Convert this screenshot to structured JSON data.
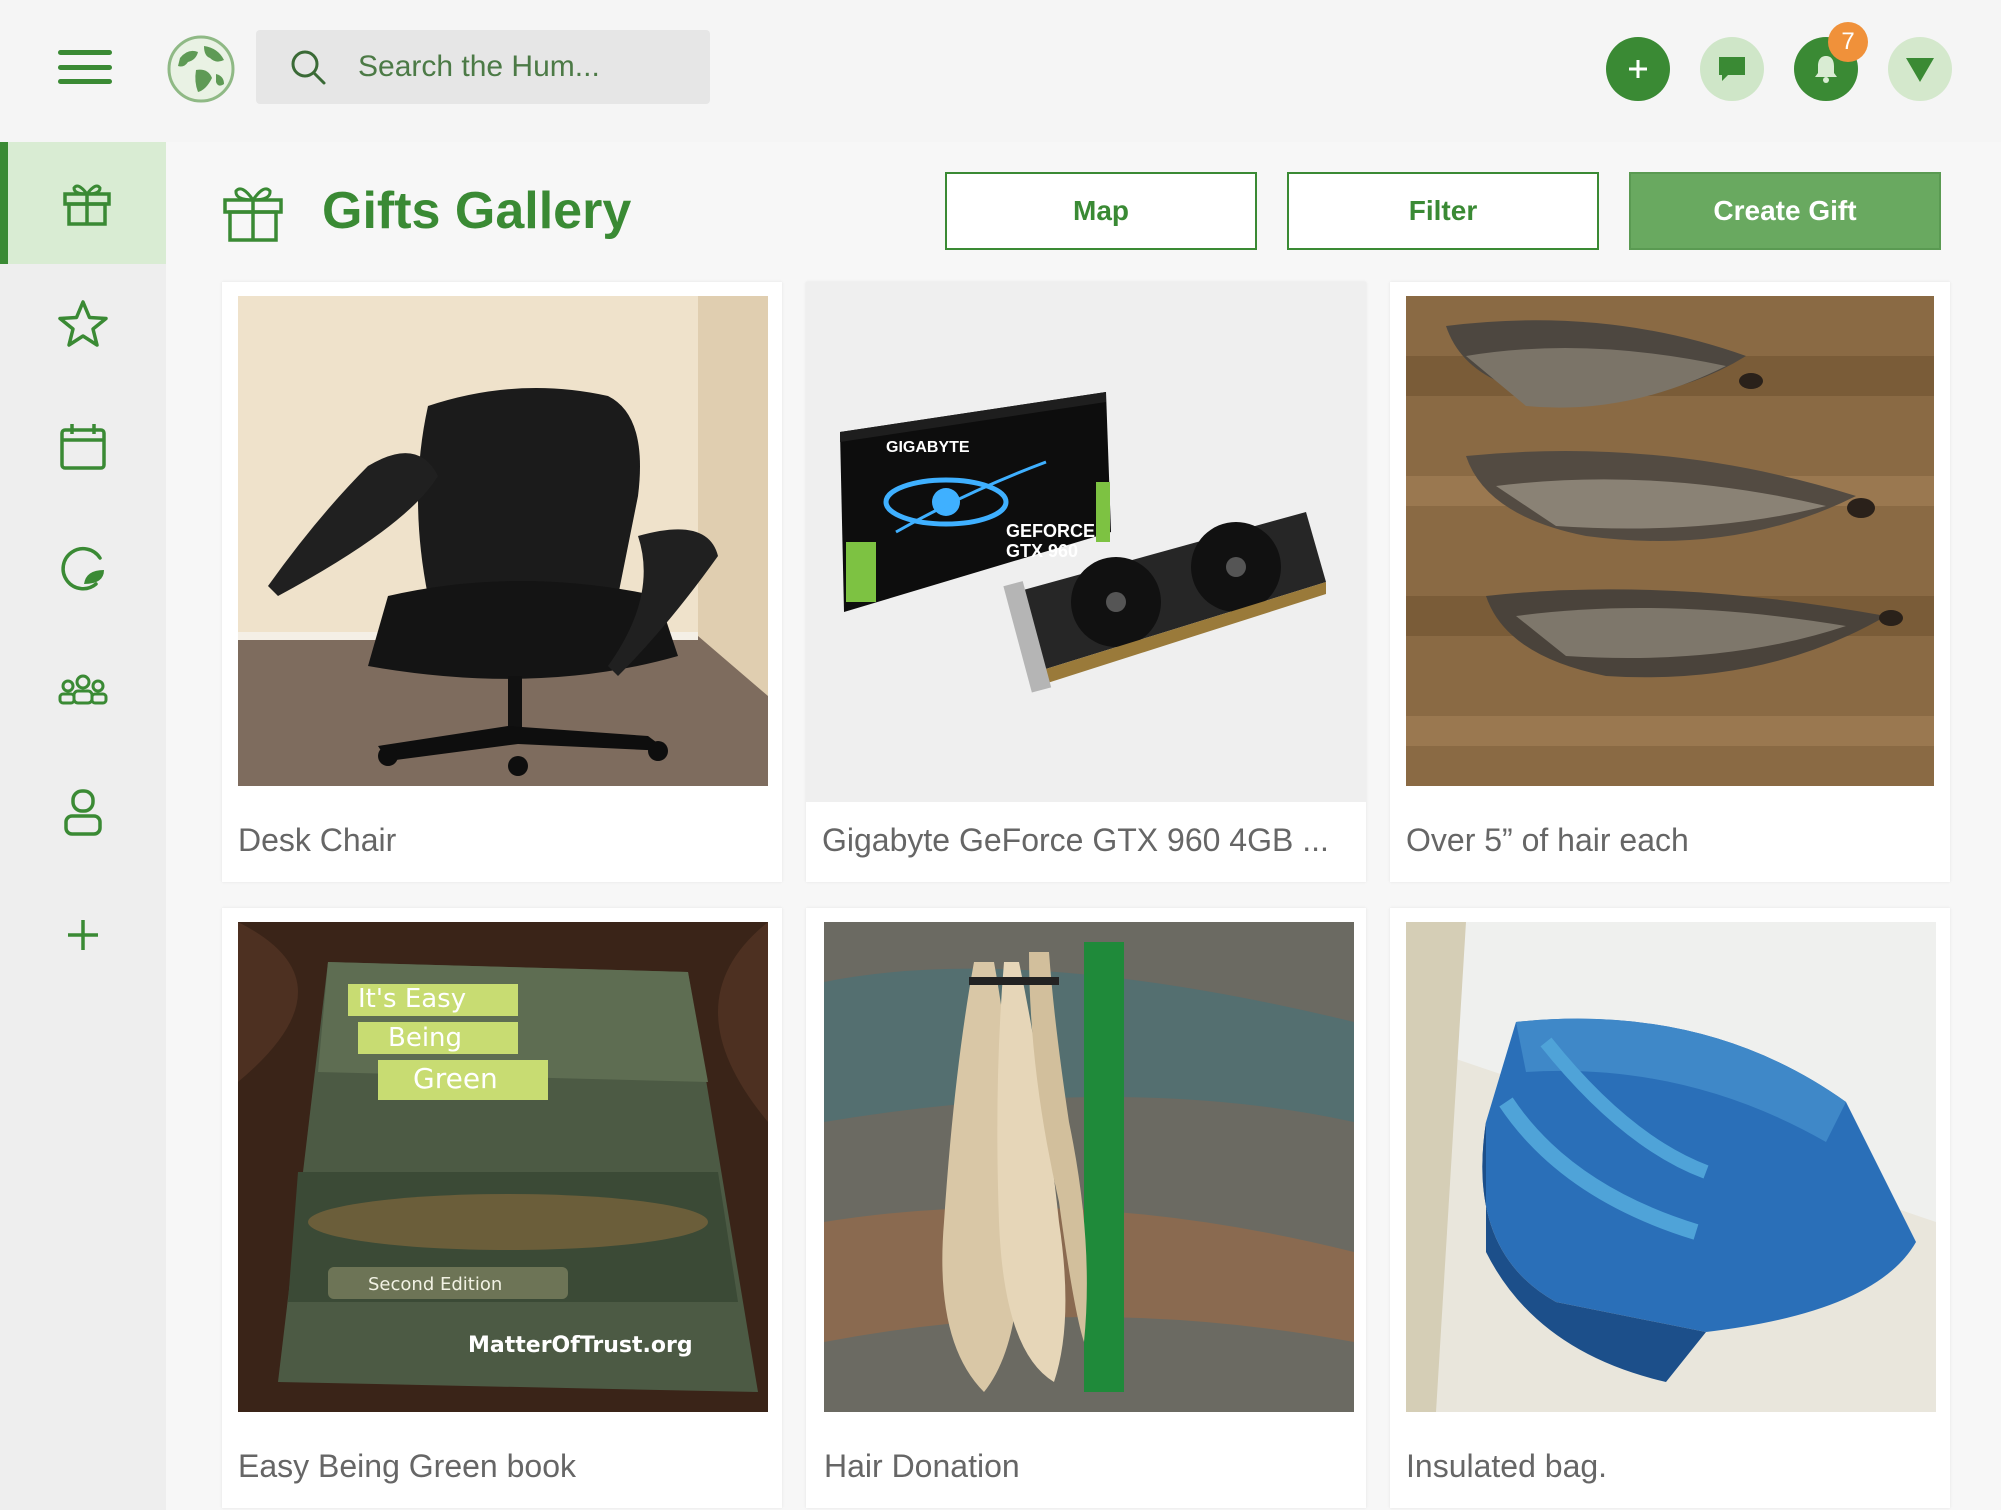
{
  "header": {
    "search_placeholder": "Search the Hum...",
    "notification_count": "7"
  },
  "page": {
    "title": "Gifts Gallery",
    "map_label": "Map",
    "filter_label": "Filter",
    "create_label": "Create Gift"
  },
  "sidebar": {
    "items": [
      {
        "icon": "gift-icon",
        "active": true
      },
      {
        "icon": "star-icon"
      },
      {
        "icon": "calendar-icon"
      },
      {
        "icon": "leaf-icon"
      },
      {
        "icon": "group-icon"
      },
      {
        "icon": "user-icon"
      },
      {
        "icon": "plus-icon"
      }
    ]
  },
  "gifts": [
    {
      "title": "Desk Chair",
      "image": "black leather office chair"
    },
    {
      "title": "Gigabyte GeForce GTX 960 4GB ...",
      "image": "graphics card with box"
    },
    {
      "title": "Over 5” of hair each",
      "image": "hair ponytails on wood floor"
    },
    {
      "title": "Easy Being Green book",
      "image": "book on leather chair"
    },
    {
      "title": "Hair Donation",
      "image": "blonde hair with ruler"
    },
    {
      "title": "Insulated bag.",
      "image": "blue insulated bag"
    }
  ],
  "colors": {
    "brand_green": "#3a8a34",
    "create_button": "#69a960",
    "badge": "#f0913a"
  }
}
